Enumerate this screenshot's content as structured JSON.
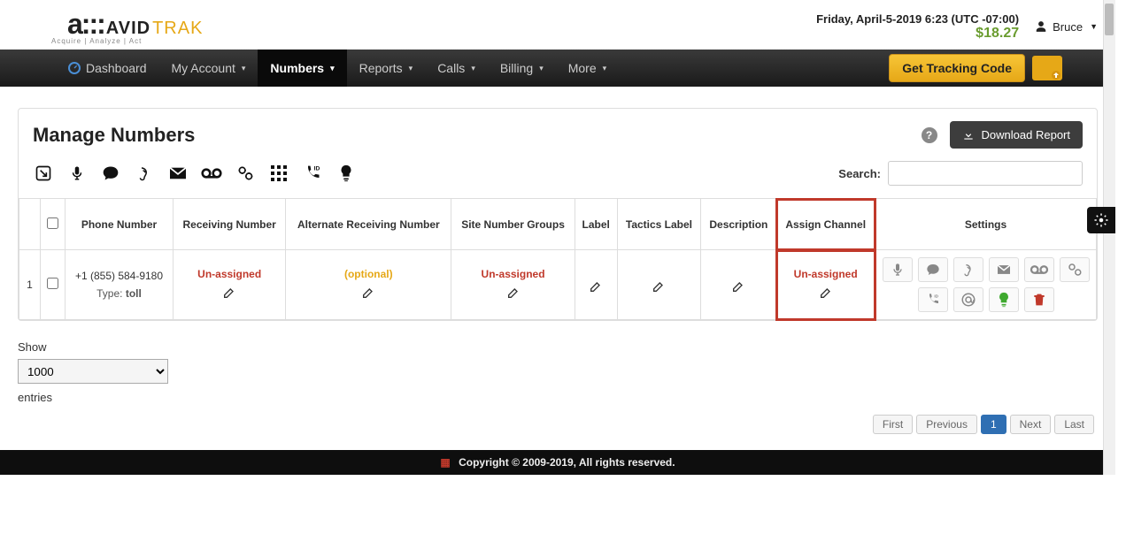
{
  "header": {
    "logo_avid": "AVID",
    "logo_trak": "TRAK",
    "logo_sub": "Acquire  |  Analyze  |  Act",
    "datetime": "Friday, April-5-2019 6:23 (UTC -07:00)",
    "balance": "$18.27",
    "user_name": "Bruce"
  },
  "nav": {
    "dashboard": "Dashboard",
    "my_account": "My Account",
    "numbers": "Numbers",
    "reports": "Reports",
    "calls": "Calls",
    "billing": "Billing",
    "more": "More",
    "get_tracking": "Get Tracking Code"
  },
  "panel": {
    "title": "Manage Numbers",
    "download": "Download Report",
    "search_label": "Search:"
  },
  "columns": {
    "phone": "Phone Number",
    "receiving": "Receiving Number",
    "alt_receiving": "Alternate Receiving Number",
    "site_groups": "Site Number Groups",
    "label": "Label",
    "tactics": "Tactics Label",
    "description": "Description",
    "assign_channel": "Assign Channel",
    "settings": "Settings"
  },
  "rows": [
    {
      "idx": "1",
      "phone": "+1 (855) 584-9180",
      "type_label": "Type:",
      "type_value": "toll",
      "receiving": "Un-assigned",
      "alt_receiving": "(optional)",
      "site_groups": "Un-assigned",
      "assign_channel": "Un-assigned"
    }
  ],
  "below": {
    "show": "Show",
    "show_value": "1000",
    "entries": "entries"
  },
  "pager": {
    "first": "First",
    "previous": "Previous",
    "page1": "1",
    "next": "Next",
    "last": "Last"
  },
  "footer": "Copyright © 2009-2019, All rights reserved."
}
